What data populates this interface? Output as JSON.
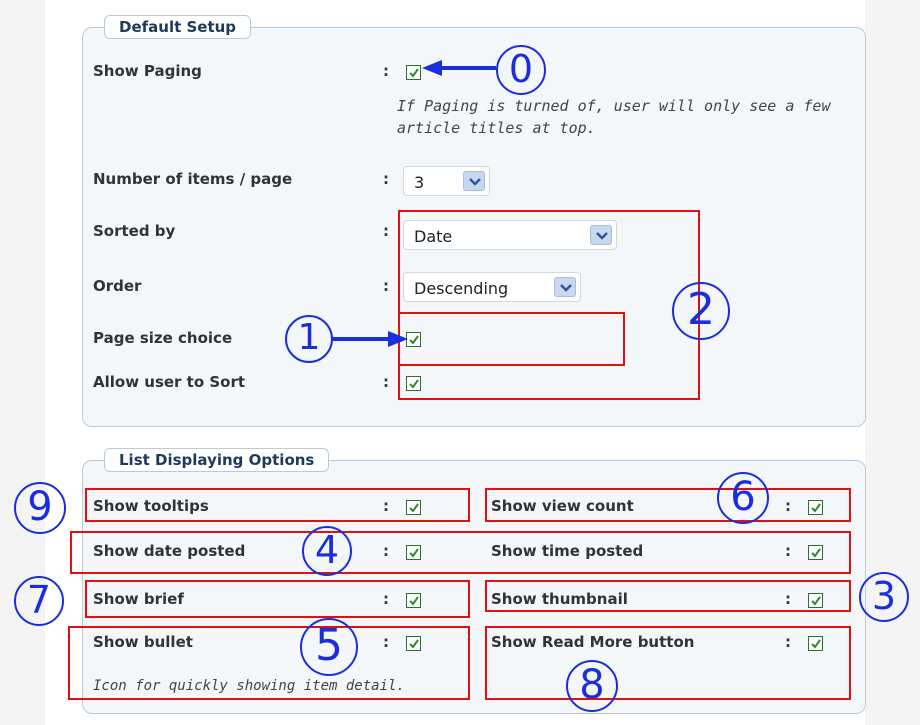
{
  "default_setup": {
    "legend": "Default Setup",
    "show_paging": {
      "label": "Show Paging",
      "checked": true
    },
    "paging_note": "If Paging is turned of, user will only see a few article titles at top.",
    "items_per_page": {
      "label": "Number of items / page",
      "value": "3"
    },
    "sorted_by": {
      "label": "Sorted by",
      "value": "Date"
    },
    "order": {
      "label": "Order",
      "value": "Descending"
    },
    "page_size_choice": {
      "label": "Page size choice",
      "checked": true
    },
    "allow_sort": {
      "label": "Allow user to Sort",
      "checked": true
    },
    "colon": ":"
  },
  "list_options": {
    "legend": "List Displaying Options",
    "show_tooltips": {
      "label": "Show tooltips",
      "checked": true
    },
    "show_view_count": {
      "label": "Show view count",
      "checked": true
    },
    "show_date_posted": {
      "label": "Show date posted",
      "checked": true
    },
    "show_time_posted": {
      "label": "Show time posted",
      "checked": true
    },
    "show_brief": {
      "label": "Show brief",
      "checked": true
    },
    "show_thumbnail": {
      "label": "Show thumbnail",
      "checked": true
    },
    "show_bullet": {
      "label": "Show bullet",
      "checked": true
    },
    "bullet_note": "Icon for quickly showing item detail.",
    "show_read_more": {
      "label": "Show Read More button",
      "checked": true
    }
  },
  "annotations": {
    "badge_0": "0",
    "badge_1": "1",
    "badge_2": "2",
    "badge_3": "3",
    "badge_4": "4",
    "badge_5": "5",
    "badge_6": "6",
    "badge_7": "7",
    "badge_8": "8",
    "badge_9": "9"
  },
  "colors": {
    "highlight_red": "#e01010",
    "annotation_blue": "#1a2ee0",
    "checkbox_green": "#2c8a2c",
    "legend_text": "#1d3a5b"
  }
}
